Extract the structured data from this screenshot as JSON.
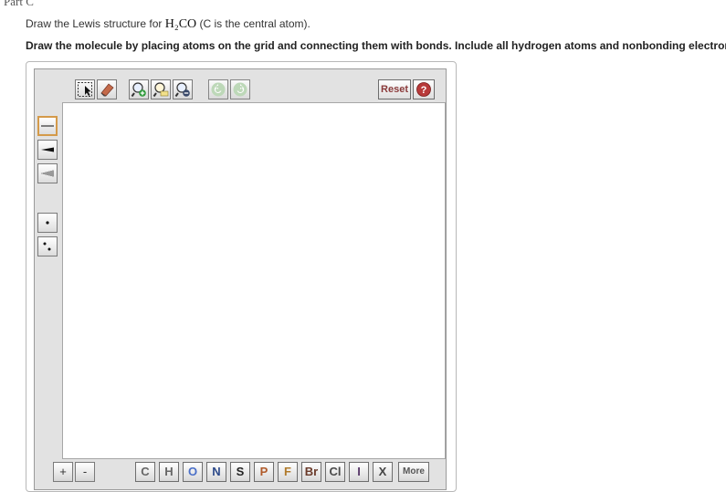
{
  "part_title": "Part C",
  "question": {
    "prefix": "Draw the Lewis structure for ",
    "formula": "H₂CO",
    "suffix": " (C is the central atom)."
  },
  "instruction": "Draw the molecule by placing atoms on the grid and connecting them with bonds. Include all hydrogen atoms and nonbonding electrons.",
  "toolbar": {
    "reset_label": "Reset",
    "help_label": "?"
  },
  "zoom": {
    "in_label": "+",
    "out_label": "-"
  },
  "atoms": [
    {
      "symbol": "C",
      "color": "#666666"
    },
    {
      "symbol": "H",
      "color": "#666666"
    },
    {
      "symbol": "O",
      "color": "#4a6fc8"
    },
    {
      "symbol": "N",
      "color": "#2d4a8a"
    },
    {
      "symbol": "S",
      "color": "#222222"
    },
    {
      "symbol": "P",
      "color": "#b05a2a"
    },
    {
      "symbol": "F",
      "color": "#b07a2a"
    },
    {
      "symbol": "Br",
      "color": "#6a3a2a"
    },
    {
      "symbol": "Cl",
      "color": "#4a4a4a"
    },
    {
      "symbol": "I",
      "color": "#5a3a6a"
    },
    {
      "symbol": "X",
      "color": "#444444"
    }
  ],
  "more_label": "More",
  "colors": {
    "accent_selected": "#d49a4a",
    "editor_bg": "#e2e2e2",
    "reset_text": "#8a3a3a"
  }
}
